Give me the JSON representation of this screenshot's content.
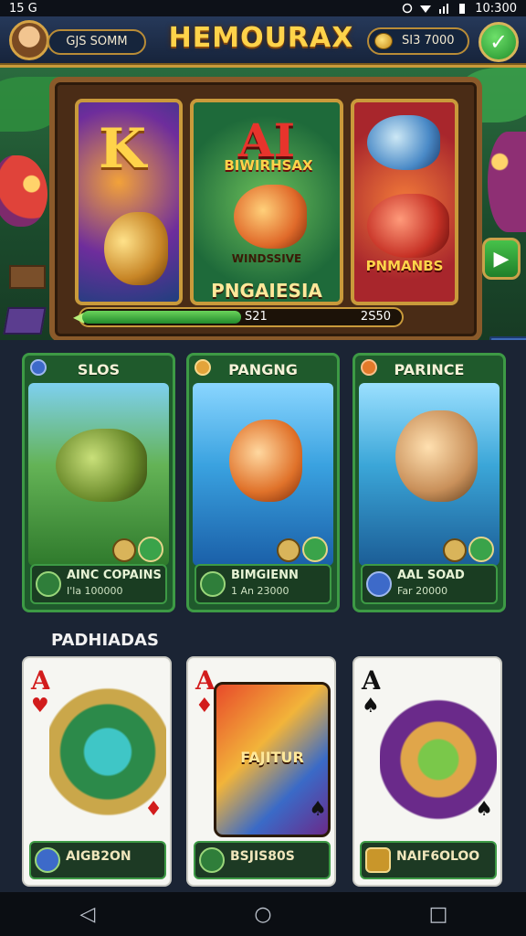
{
  "status_bar": {
    "left_text": "15 G",
    "time": "10:300"
  },
  "header": {
    "player_name": "GJS SOMM",
    "title": "HEMOURAX",
    "coin_balance": "SI3 7000",
    "confirm_icon": "check-icon"
  },
  "hero": {
    "slots": [
      {
        "letter": "K"
      },
      {
        "headline": "AI",
        "banner": "BIWIRHSAX",
        "sub": "WINDSSIVE",
        "name": "PNGAIESIA"
      },
      {
        "name": "PNMANBS"
      }
    ],
    "progress": {
      "current": "S21",
      "max": "2S50",
      "fraction": 0.5
    },
    "next_icon": "arrow-right-icon"
  },
  "games": [
    {
      "title": "SLOS",
      "footer_name": "AINC COPAINS",
      "footer_sub": "I'la 100000"
    },
    {
      "title": "PANGNG",
      "footer_name": "BIMGIENN",
      "footer_sub": "1 An 23000"
    },
    {
      "title": "PARINCE",
      "footer_name": "AAL SOAD",
      "footer_sub": "Far 20000"
    }
  ],
  "cards_section": {
    "title": "PADHIADAS",
    "cards": [
      {
        "rank": "A",
        "suit": "♥",
        "suit_color": "#d21c1c",
        "corner_suit": "♦",
        "footer_name": "AIGB2ON",
        "footer_sub": ""
      },
      {
        "rank": "A",
        "suit": "♦",
        "suit_color": "#d21c1c",
        "corner_suit": "♠",
        "footer_name": "BSJIS80S",
        "footer_sub": "",
        "art_text": "FAJITUR"
      },
      {
        "rank": "A",
        "suit": "♠",
        "suit_color": "#111111",
        "corner_suit": "♠",
        "footer_name": "NAIF6OLOO",
        "footer_sub": ""
      }
    ]
  },
  "navbar": {
    "back": "◁",
    "home": "○",
    "recents": "□"
  }
}
